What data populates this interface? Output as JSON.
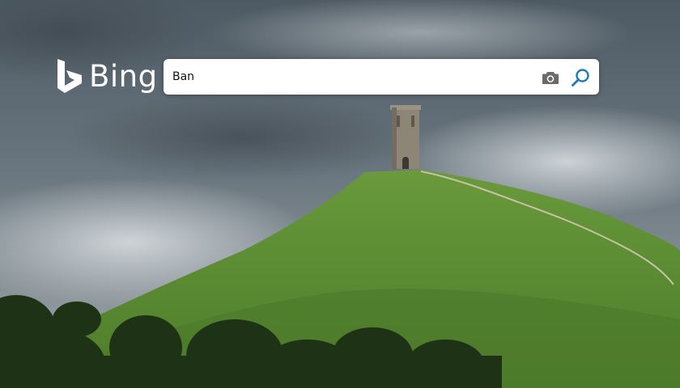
{
  "brand": {
    "name": "Bing",
    "logo_icon": "bing-b-icon"
  },
  "search": {
    "value": "Ban",
    "camera_icon": "camera-icon",
    "search_icon": "magnifier-icon"
  },
  "colors": {
    "logo": "#ffffff",
    "search_icon": "#1b7bb6",
    "camera_icon": "#6b6b6b",
    "sky": "#5b6770",
    "hill": "#5d8c34"
  }
}
